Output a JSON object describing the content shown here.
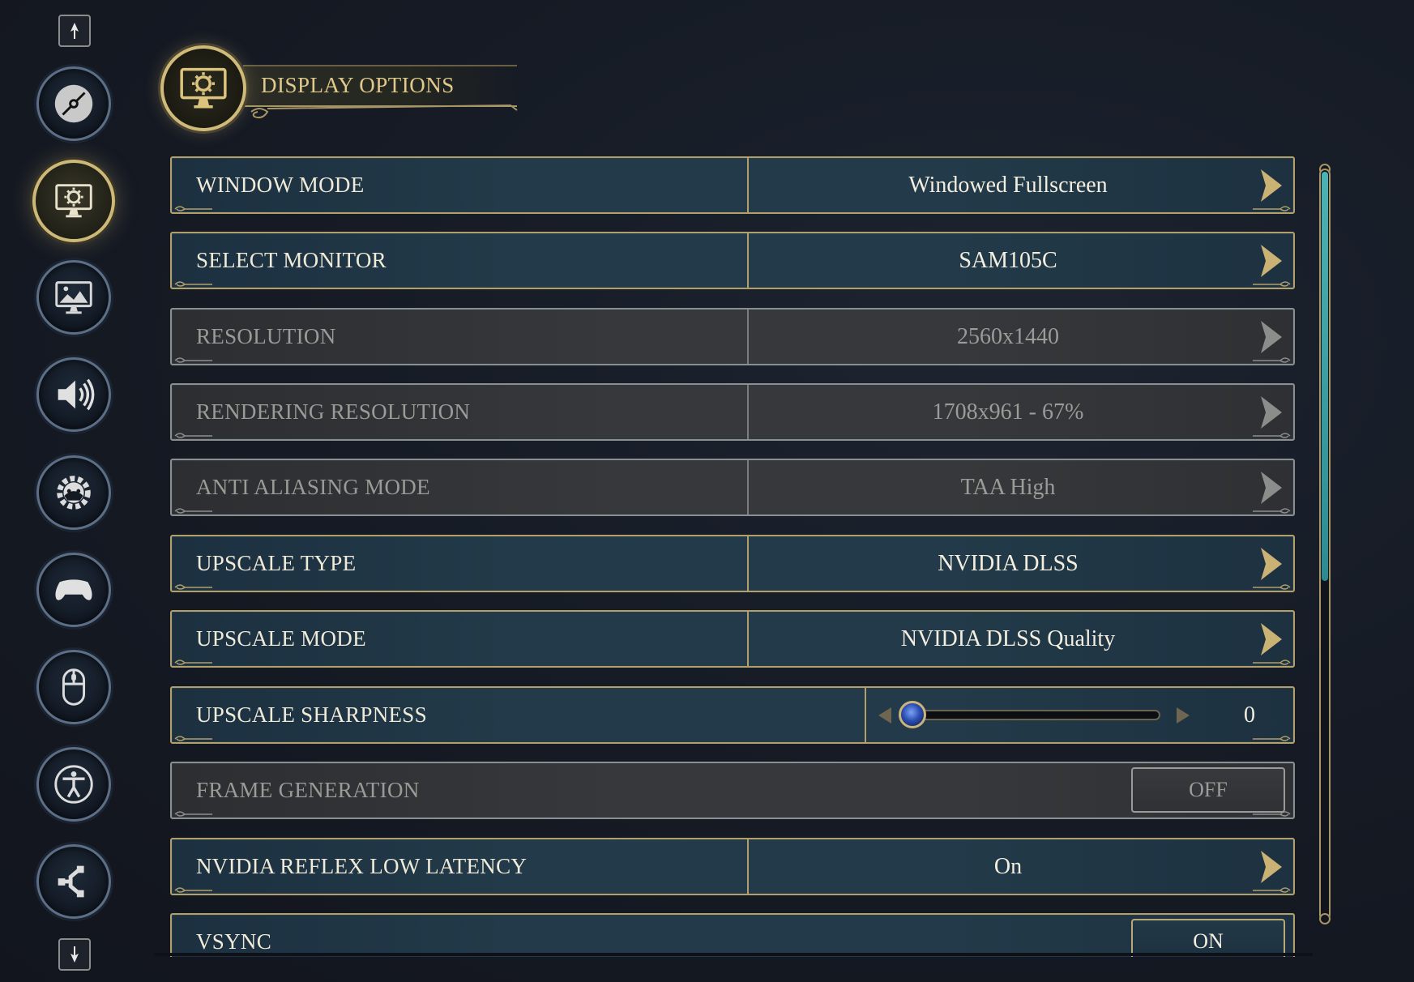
{
  "header": {
    "title": "DISPLAY OPTIONS"
  },
  "nav": {
    "items": [
      {
        "icon": "disc-icon",
        "active": false
      },
      {
        "icon": "display-monitor-gear-icon",
        "active": true
      },
      {
        "icon": "picture-monitor-icon",
        "active": false
      },
      {
        "icon": "speaker-icon",
        "active": false
      },
      {
        "icon": "gameplay-gear-icon",
        "active": false
      },
      {
        "icon": "gamepad-icon",
        "active": false
      },
      {
        "icon": "mouse-icon",
        "active": false
      },
      {
        "icon": "accessibility-icon",
        "active": false
      },
      {
        "icon": "share-network-icon",
        "active": false
      }
    ]
  },
  "settings": {
    "window_mode": {
      "label": "WINDOW MODE",
      "value": "Windowed Fullscreen"
    },
    "select_monitor": {
      "label": "SELECT MONITOR",
      "value": "SAM105C"
    },
    "resolution": {
      "label": "RESOLUTION",
      "value": "2560x1440"
    },
    "rendering_resolution": {
      "label": "RENDERING RESOLUTION",
      "value": "1708x961 - 67%"
    },
    "anti_aliasing": {
      "label": "ANTI ALIASING MODE",
      "value": "TAA High"
    },
    "upscale_type": {
      "label": "UPSCALE TYPE",
      "value": "NVIDIA DLSS"
    },
    "upscale_mode": {
      "label": "UPSCALE MODE",
      "value": "NVIDIA DLSS Quality"
    },
    "upscale_sharpness": {
      "label": "UPSCALE SHARPNESS",
      "value": "0",
      "level": 0
    },
    "frame_generation": {
      "label": "FRAME GENERATION",
      "value": "OFF"
    },
    "nvidia_reflex": {
      "label": "NVIDIA REFLEX LOW LATENCY",
      "value": "On"
    },
    "vsync": {
      "label": "VSYNC",
      "value": "ON"
    }
  },
  "colors": {
    "gold_border": "#b19f6c",
    "row_teal": "#223a49",
    "disabled_grey": "#36383b",
    "scroll_thumb": "#4ab3b3"
  }
}
